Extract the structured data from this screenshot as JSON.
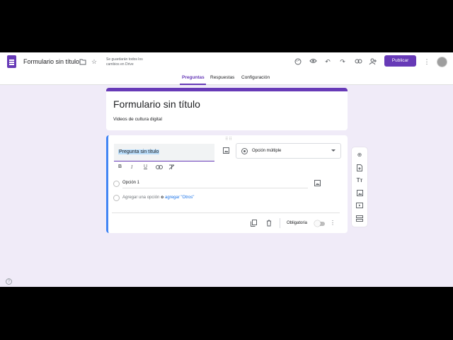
{
  "app": {
    "title": "Formulario sin título",
    "saved_status": "Se guardarán todos los cambios en Drive",
    "publish_label": "Publicar"
  },
  "tabs": [
    {
      "label": "Preguntas",
      "active": true
    },
    {
      "label": "Respuestas",
      "active": false
    },
    {
      "label": "Configuración",
      "active": false
    }
  ],
  "form": {
    "title": "Formulario sin título",
    "description": "Videos de cultura digital"
  },
  "question": {
    "title": "Pregunta sin título",
    "type": "Opción múltiple",
    "options": [
      "Opción 1"
    ],
    "add_option": "Agregar una opción",
    "or": "o",
    "add_other": "agregar \"Otros\"",
    "required_label": "Obligatoria",
    "required": false
  },
  "icons": {
    "format": {
      "bold": "B",
      "italic": "I",
      "underline": "U"
    }
  },
  "colors": {
    "accent": "#673ab7",
    "active_border": "#4285f4",
    "background": "#f0ebf8"
  }
}
